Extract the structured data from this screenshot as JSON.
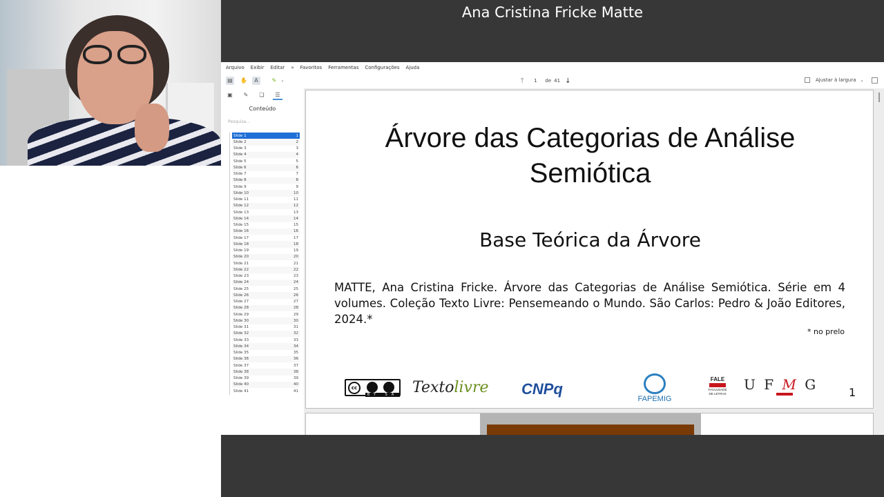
{
  "presenter": {
    "name": "Ana Cristina Fricke Matte"
  },
  "menu": [
    "Arquivo",
    "Exibir",
    "Editar",
    "»",
    "Favoritos",
    "Ferramentas",
    "Configurações",
    "Ajuda"
  ],
  "toolbar": {
    "current_page": "1",
    "of_label": "de",
    "total_pages": "41",
    "zoom_label": "Ajustar à largura"
  },
  "sidebar": {
    "title": "Conteúdo",
    "search_placeholder": "Pesquisa...",
    "slides": [
      {
        "label": "Slide 1",
        "page": "1"
      },
      {
        "label": "Slide 2",
        "page": "2"
      },
      {
        "label": "Slide 3",
        "page": "3"
      },
      {
        "label": "Slide 4",
        "page": "4"
      },
      {
        "label": "Slide 5",
        "page": "5"
      },
      {
        "label": "Slide 6",
        "page": "6"
      },
      {
        "label": "Slide 7",
        "page": "7"
      },
      {
        "label": "Slide 8",
        "page": "8"
      },
      {
        "label": "Slide 9",
        "page": "9"
      },
      {
        "label": "Slide 10",
        "page": "10"
      },
      {
        "label": "Slide 11",
        "page": "11"
      },
      {
        "label": "Slide 12",
        "page": "12"
      },
      {
        "label": "Slide 13",
        "page": "13"
      },
      {
        "label": "Slide 14",
        "page": "14"
      },
      {
        "label": "Slide 15",
        "page": "15"
      },
      {
        "label": "Slide 16",
        "page": "16"
      },
      {
        "label": "Slide 17",
        "page": "17"
      },
      {
        "label": "Slide 18",
        "page": "18"
      },
      {
        "label": "Slide 19",
        "page": "19"
      },
      {
        "label": "Slide 20",
        "page": "20"
      },
      {
        "label": "Slide 21",
        "page": "21"
      },
      {
        "label": "Slide 22",
        "page": "22"
      },
      {
        "label": "Slide 23",
        "page": "23"
      },
      {
        "label": "Slide 24",
        "page": "24"
      },
      {
        "label": "Slide 25",
        "page": "25"
      },
      {
        "label": "Slide 26",
        "page": "26"
      },
      {
        "label": "Slide 27",
        "page": "27"
      },
      {
        "label": "Slide 28",
        "page": "28"
      },
      {
        "label": "Slide 29",
        "page": "29"
      },
      {
        "label": "Slide 30",
        "page": "30"
      },
      {
        "label": "Slide 31",
        "page": "31"
      },
      {
        "label": "Slide 32",
        "page": "32"
      },
      {
        "label": "Slide 33",
        "page": "33"
      },
      {
        "label": "Slide 34",
        "page": "34"
      },
      {
        "label": "Slide 35",
        "page": "35"
      },
      {
        "label": "Slide 36",
        "page": "36"
      },
      {
        "label": "Slide 37",
        "page": "37"
      },
      {
        "label": "Slide 38",
        "page": "38"
      },
      {
        "label": "Slide 39",
        "page": "39"
      },
      {
        "label": "Slide 40",
        "page": "40"
      },
      {
        "label": "Slide 41",
        "page": "41"
      }
    ],
    "selected_index": 0
  },
  "slide": {
    "title_line1": "Árvore das Categorias de Análise",
    "title_line2": "Semiótica",
    "subtitle": "Base Teórica da Árvore",
    "citation": "MATTE, Ana Cristina Fricke. Árvore das Categorias de Análise Semiótica. Série em 4 volumes. Coleção Texto Livre: Pensemeando o Mundo. São Carlos: Pedro & João Editores, 2024.*",
    "note": "* no prelo",
    "page_number": "1",
    "logos": {
      "cc_badge": "BY SA",
      "texto": "Texto",
      "livre": "livre",
      "cnpq": "CNPq",
      "fapemig": "FAPEMIG",
      "fale": "FALE",
      "fale_sub1": "FACULDADE",
      "fale_sub2": "DE LETRAS",
      "ufmg_u": "U F",
      "ufmg_m": "M",
      "ufmg_g": "G"
    }
  },
  "colors": {
    "dark_bar": "#373737",
    "selection": "#1e6fd6",
    "ufmg_red": "#c8161d",
    "cnpq_blue": "#1f4e9c"
  }
}
